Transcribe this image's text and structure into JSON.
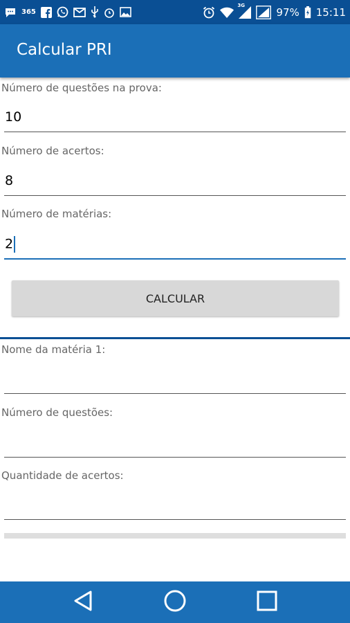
{
  "status_bar": {
    "left_icons": [
      "chat-icon",
      "carrier-icon",
      "facebook-icon",
      "whatsapp-icon",
      "mail-icon",
      "usb-icon",
      "alarm-icon",
      "image-icon"
    ],
    "carrier_label": "365",
    "right_icons": [
      "alarm-icon",
      "wifi-icon",
      "signal-3g-icon",
      "signal-icon",
      "battery-icon"
    ],
    "network_label": "3G",
    "battery": "97%",
    "time": "15:11"
  },
  "app_bar": {
    "title": "Calcular PRI"
  },
  "form": {
    "questions_label": "Número de questões na prova:",
    "questions_value": "10",
    "hits_label": "Número de acertos:",
    "hits_value": "8",
    "subjects_label": "Número de matérias:",
    "subjects_value": "2",
    "calculate_label": "CALCULAR"
  },
  "subject_form": {
    "name_label": "Nome da matéria 1:",
    "name_value": "",
    "questions_label": "Número de questões:",
    "questions_value": "",
    "hits_label": "Quantidade de acertos:",
    "hits_value": ""
  },
  "colors": {
    "status_bar": "#0a4f94",
    "app_bar": "#1b6fb7",
    "accent": "#1b6fb7",
    "button": "#d8d8d8"
  }
}
